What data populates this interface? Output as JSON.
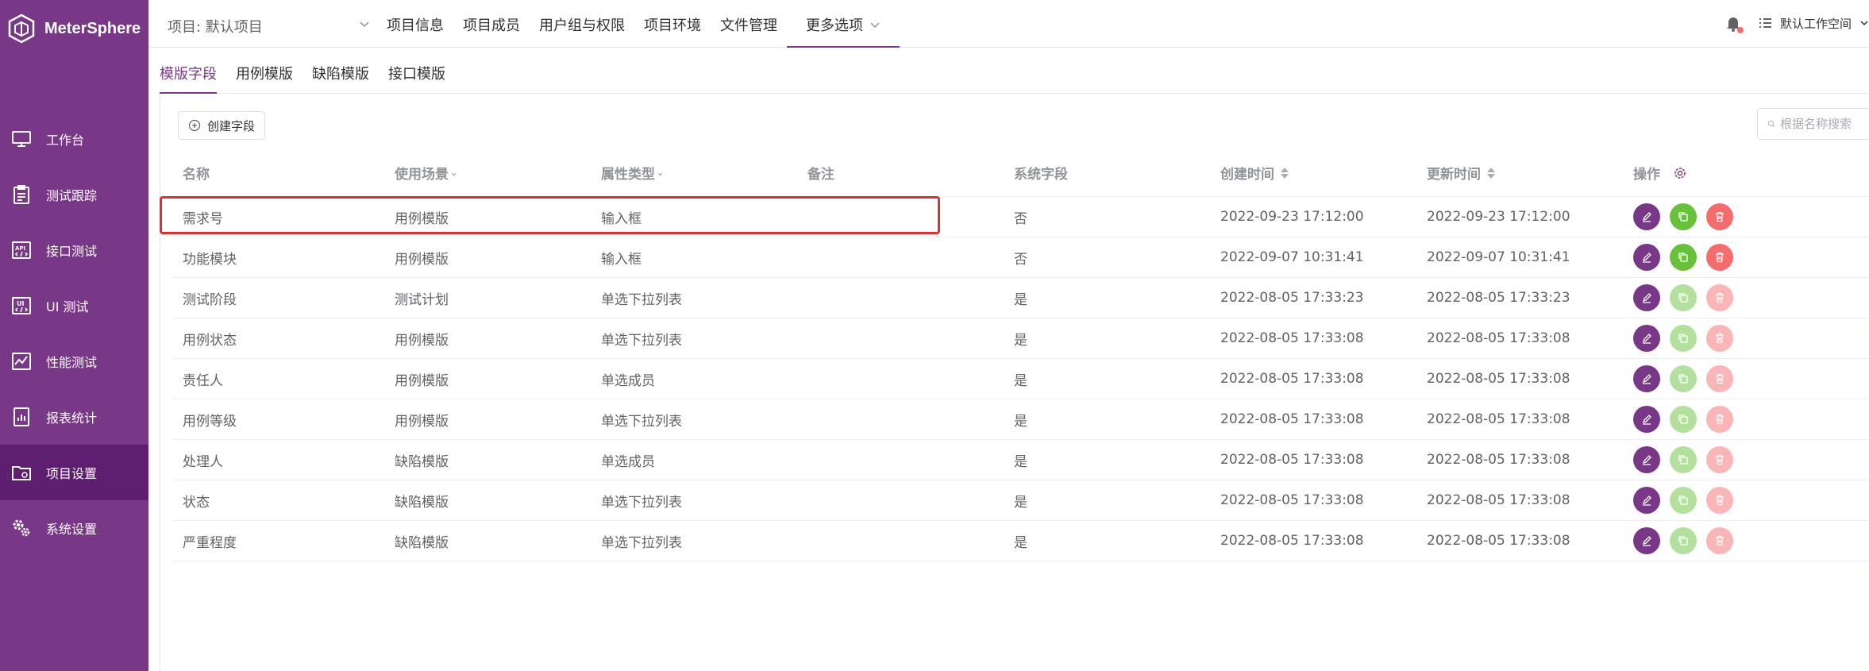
{
  "app": {
    "brand": "MeterSphere"
  },
  "sidebar": {
    "items": [
      {
        "label": "工作台",
        "icon": "monitor-icon"
      },
      {
        "label": "测试跟踪",
        "icon": "clipboard-icon"
      },
      {
        "label": "接口测试",
        "icon": "api-icon"
      },
      {
        "label": "UI 测试",
        "icon": "ui-icon"
      },
      {
        "label": "性能测试",
        "icon": "performance-icon"
      },
      {
        "label": "报表统计",
        "icon": "report-icon"
      },
      {
        "label": "项目设置",
        "icon": "folder-settings-icon",
        "active": true
      },
      {
        "label": "系统设置",
        "icon": "gears-icon"
      }
    ]
  },
  "topbar": {
    "project": "项目: 默认项目",
    "nav": [
      "项目信息",
      "项目成员",
      "用户组与权限",
      "项目环境",
      "文件管理"
    ],
    "more": "更多选项",
    "workspace": "默认工作空间"
  },
  "subtabs": [
    "模版字段",
    "用例模版",
    "缺陷模版",
    "接口模版"
  ],
  "toolbar": {
    "create_label": "创建字段",
    "search_placeholder": "根据名称搜索"
  },
  "table": {
    "headers": [
      "名称",
      "使用场景",
      "属性类型",
      "备注",
      "系统字段",
      "创建时间",
      "更新时间",
      "操作"
    ],
    "rows": [
      {
        "name": "需求号",
        "scene": "用例模版",
        "type": "输入框",
        "remark": "",
        "system": "否",
        "created": "2022-09-23 17:12:00",
        "updated": "2022-09-23 17:12:00"
      },
      {
        "name": "功能模块",
        "scene": "用例模版",
        "type": "输入框",
        "remark": "",
        "system": "否",
        "created": "2022-09-07 10:31:41",
        "updated": "2022-09-07 10:31:41"
      },
      {
        "name": "测试阶段",
        "scene": "测试计划",
        "type": "单选下拉列表",
        "remark": "",
        "system": "是",
        "created": "2022-08-05 17:33:23",
        "updated": "2022-08-05 17:33:23"
      },
      {
        "name": "用例状态",
        "scene": "用例模版",
        "type": "单选下拉列表",
        "remark": "",
        "system": "是",
        "created": "2022-08-05 17:33:08",
        "updated": "2022-08-05 17:33:08"
      },
      {
        "name": "责任人",
        "scene": "用例模版",
        "type": "单选成员",
        "remark": "",
        "system": "是",
        "created": "2022-08-05 17:33:08",
        "updated": "2022-08-05 17:33:08"
      },
      {
        "name": "用例等级",
        "scene": "用例模版",
        "type": "单选下拉列表",
        "remark": "",
        "system": "是",
        "created": "2022-08-05 17:33:08",
        "updated": "2022-08-05 17:33:08"
      },
      {
        "name": "处理人",
        "scene": "缺陷模版",
        "type": "单选成员",
        "remark": "",
        "system": "是",
        "created": "2022-08-05 17:33:08",
        "updated": "2022-08-05 17:33:08"
      },
      {
        "name": "状态",
        "scene": "缺陷模版",
        "type": "单选下拉列表",
        "remark": "",
        "system": "是",
        "created": "2022-08-05 17:33:08",
        "updated": "2022-08-05 17:33:08"
      },
      {
        "name": "严重程度",
        "scene": "缺陷模版",
        "type": "单选下拉列表",
        "remark": "",
        "system": "是",
        "created": "2022-08-05 17:33:08",
        "updated": "2022-08-05 17:33:08"
      }
    ]
  },
  "colors": {
    "brand": "#783887",
    "copy": "#67c23a",
    "delete": "#f56c6c",
    "highlight": "#e62c2c"
  }
}
